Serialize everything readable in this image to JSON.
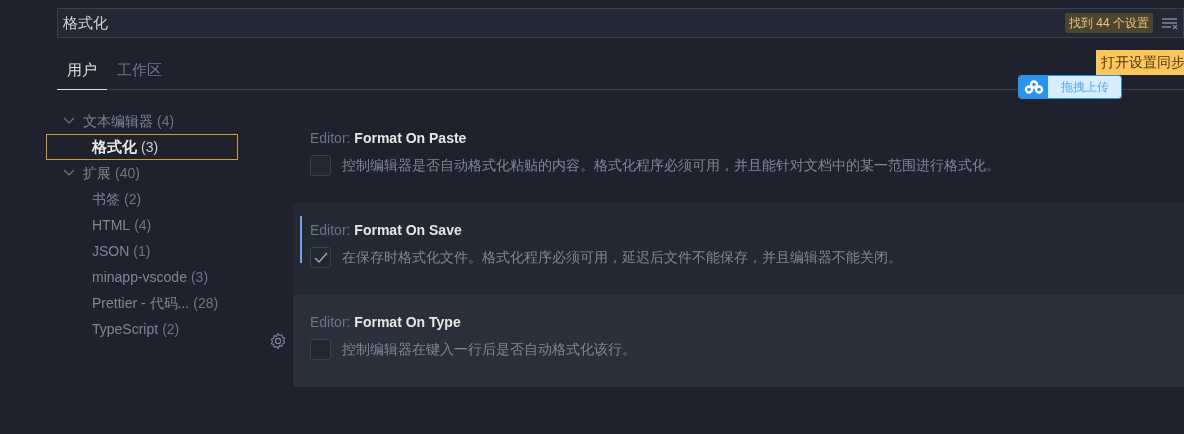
{
  "search": {
    "value": "格式化",
    "result_badge": "找到 44 个设置"
  },
  "tabs": [
    {
      "label": "用户",
      "selected": true
    },
    {
      "label": "工作区",
      "selected": false
    }
  ],
  "sync_tooltip": "打开设置同步",
  "upload_widget": {
    "label": "拖拽上传"
  },
  "tree": [
    {
      "label": "文本编辑器",
      "count": "(4)",
      "expanded": true,
      "selected": false,
      "children": [
        {
          "label": "格式化",
          "count": "(3)",
          "selected": true
        }
      ]
    },
    {
      "label": "扩展",
      "count": "(40)",
      "expanded": true,
      "selected": false,
      "children": [
        {
          "label": "书签",
          "count": "(2)",
          "selected": false
        },
        {
          "label": "HTML",
          "count": "(4)",
          "selected": false
        },
        {
          "label": "JSON",
          "count": "(1)",
          "selected": false
        },
        {
          "label": "minapp-vscode",
          "count": "(3)",
          "selected": false
        },
        {
          "label": "Prettier - 代码...",
          "count": "(28)",
          "selected": false
        },
        {
          "label": "TypeScript",
          "count": "(2)",
          "selected": false
        }
      ]
    }
  ],
  "settings": [
    {
      "category": "Editor:",
      "title": "Format On Paste",
      "description": "控制编辑器是否自动格式化粘贴的内容。格式化程序必须可用，并且能针对文档中的某一范围进行格式化。",
      "checked": false,
      "selected": false,
      "hovered": false
    },
    {
      "category": "Editor:",
      "title": "Format On Save",
      "description": "在保存时格式化文件。格式化程序必须可用，延迟后文件不能保存，并且编辑器不能关闭。",
      "checked": true,
      "selected": true,
      "hovered": false
    },
    {
      "category": "Editor:",
      "title": "Format On Type",
      "description": "控制编辑器在键入一行后是否自动格式化该行。",
      "checked": false,
      "selected": false,
      "hovered": true
    }
  ]
}
